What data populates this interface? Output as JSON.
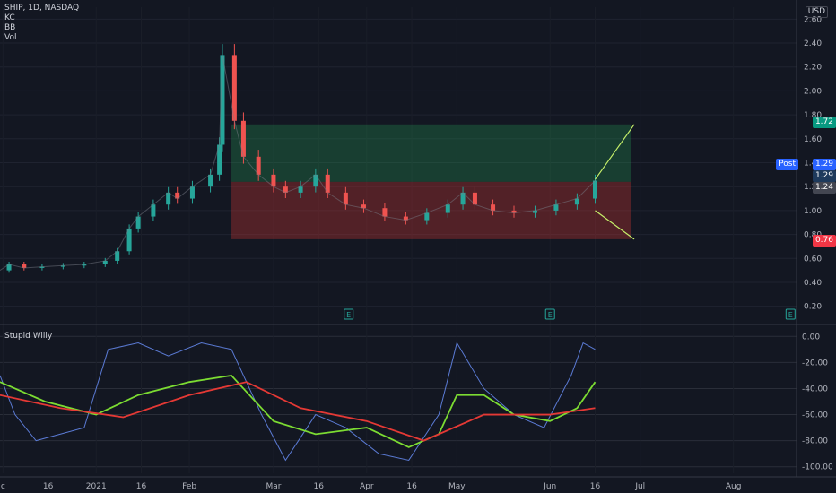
{
  "header": {
    "symbol_line": "SHIP, 1D, NASDAQ",
    "indicators": [
      "KC",
      "BB",
      "Vol"
    ]
  },
  "currency": "USD",
  "oscillator": {
    "name": "Stupid Willy"
  },
  "colors": {
    "bg": "#131722",
    "up": "#26a69a",
    "down": "#ef5350",
    "grid": "#2a2e39",
    "green_zone": "#1b5e20",
    "red_zone": "#b71c1c"
  },
  "price_tags": [
    {
      "label": "1.72",
      "value": 1.72,
      "color": "#089981"
    },
    {
      "label": "Post",
      "value": 1.29,
      "color": "#2962ff",
      "extra": "1.29"
    },
    {
      "label": "1.29",
      "value": 1.26,
      "color": "#1e3a5c"
    },
    {
      "label": "1.24",
      "value": 1.24,
      "color": "#434651"
    },
    {
      "label": "0.76",
      "value": 0.76,
      "color": "#f23645"
    }
  ],
  "chart_data": [
    {
      "type": "candlestick",
      "title": "SHIP, 1D, NASDAQ",
      "y_ticks": [
        "2.60",
        "2.40",
        "2.20",
        "2.00",
        "1.80",
        "1.60",
        "1.40",
        "1.20",
        "1.00",
        "0.80",
        "0.60",
        "0.40",
        "0.20"
      ],
      "y_tick_values": [
        2.6,
        2.4,
        2.2,
        2.0,
        1.8,
        1.6,
        1.4,
        1.2,
        1.0,
        0.8,
        0.6,
        0.4,
        0.2
      ],
      "ylim": [
        0.1,
        2.7
      ],
      "x_ticks": [
        "c",
        "16",
        "2021",
        "16",
        "Feb",
        "Mar",
        "16",
        "Apr",
        "16",
        "May",
        "Jun",
        "16",
        "Jul",
        "Aug"
      ],
      "x_tick_pos": [
        "2020-12-01",
        "2020-12-16",
        "2021-01-01",
        "2021-01-16",
        "2021-02-01",
        "2021-03-01",
        "2021-03-16",
        "2021-04-01",
        "2021-04-16",
        "2021-05-01",
        "2021-06-01",
        "2021-06-16",
        "2021-07-01",
        "2021-08-01"
      ],
      "xlim": [
        "2020-11-30",
        "2021-08-22"
      ],
      "close_series": [
        [
          "2020-11-30",
          0.5
        ],
        [
          "2020-12-03",
          0.55
        ],
        [
          "2020-12-08",
          0.52
        ],
        [
          "2020-12-14",
          0.53
        ],
        [
          "2020-12-21",
          0.54
        ],
        [
          "2020-12-28",
          0.55
        ],
        [
          "2021-01-04",
          0.58
        ],
        [
          "2021-01-08",
          0.66
        ],
        [
          "2021-01-12",
          0.85
        ],
        [
          "2021-01-15",
          0.95
        ],
        [
          "2021-01-20",
          1.05
        ],
        [
          "2021-01-25",
          1.15
        ],
        [
          "2021-01-28",
          1.1
        ],
        [
          "2021-02-02",
          1.2
        ],
        [
          "2021-02-08",
          1.3
        ],
        [
          "2021-02-11",
          1.55
        ],
        [
          "2021-02-12",
          2.3
        ],
        [
          "2021-02-16",
          1.75
        ],
        [
          "2021-02-19",
          1.45
        ],
        [
          "2021-02-24",
          1.3
        ],
        [
          "2021-03-01",
          1.2
        ],
        [
          "2021-03-05",
          1.15
        ],
        [
          "2021-03-10",
          1.2
        ],
        [
          "2021-03-15",
          1.3
        ],
        [
          "2021-03-19",
          1.15
        ],
        [
          "2021-03-25",
          1.05
        ],
        [
          "2021-03-31",
          1.02
        ],
        [
          "2021-04-07",
          0.95
        ],
        [
          "2021-04-14",
          0.92
        ],
        [
          "2021-04-21",
          0.98
        ],
        [
          "2021-04-28",
          1.05
        ],
        [
          "2021-05-03",
          1.15
        ],
        [
          "2021-05-07",
          1.05
        ],
        [
          "2021-05-13",
          1.0
        ],
        [
          "2021-05-20",
          0.98
        ],
        [
          "2021-05-27",
          1.0
        ],
        [
          "2021-06-03",
          1.05
        ],
        [
          "2021-06-10",
          1.1
        ],
        [
          "2021-06-16",
          1.25
        ]
      ],
      "zones": [
        {
          "name": "target",
          "from": 1.24,
          "to": 1.72,
          "start": "2021-02-15",
          "end": "2021-06-28"
        },
        {
          "name": "stop",
          "from": 0.76,
          "to": 1.24,
          "start": "2021-02-15",
          "end": "2021-06-28"
        }
      ],
      "arrows": [
        {
          "from": [
            "2021-06-16",
            1.26
          ],
          "to": [
            "2021-06-29",
            1.72
          ]
        },
        {
          "from": [
            "2021-06-16",
            1.0
          ],
          "to": [
            "2021-06-29",
            0.76
          ]
        }
      ],
      "earnings_markers": [
        {
          "label": "E",
          "date": "2021-03-26"
        },
        {
          "label": "E",
          "date": "2021-06-01"
        },
        {
          "label": "E",
          "date": "2021-08-20"
        }
      ]
    },
    {
      "type": "line",
      "title": "Stupid Willy",
      "y_ticks": [
        "0.00",
        "-20.00",
        "-40.00",
        "-60.00",
        "-80.00",
        "-100.00"
      ],
      "y_tick_values": [
        0,
        -20,
        -40,
        -60,
        -80,
        -100
      ],
      "ylim": [
        -105,
        5
      ],
      "series": [
        {
          "color": "#5b7bd5",
          "values": [
            [
              "2020-11-30",
              -30
            ],
            [
              "2020-12-05",
              -60
            ],
            [
              "2020-12-12",
              -80
            ],
            [
              "2020-12-20",
              -75
            ],
            [
              "2020-12-28",
              -70
            ],
            [
              "2021-01-05",
              -10
            ],
            [
              "2021-01-15",
              -5
            ],
            [
              "2021-01-25",
              -15
            ],
            [
              "2021-02-05",
              -5
            ],
            [
              "2021-02-15",
              -10
            ],
            [
              "2021-02-25",
              -60
            ],
            [
              "2021-03-05",
              -95
            ],
            [
              "2021-03-15",
              -60
            ],
            [
              "2021-03-25",
              -70
            ],
            [
              "2021-04-05",
              -90
            ],
            [
              "2021-04-15",
              -95
            ],
            [
              "2021-04-25",
              -60
            ],
            [
              "2021-05-01",
              -5
            ],
            [
              "2021-05-10",
              -40
            ],
            [
              "2021-05-20",
              -60
            ],
            [
              "2021-05-30",
              -70
            ],
            [
              "2021-06-08",
              -30
            ],
            [
              "2021-06-12",
              -5
            ],
            [
              "2021-06-16",
              -10
            ]
          ]
        },
        {
          "color": "#7cdc32",
          "values": [
            [
              "2020-11-30",
              -35
            ],
            [
              "2020-12-15",
              -50
            ],
            [
              "2021-01-01",
              -60
            ],
            [
              "2021-01-15",
              -45
            ],
            [
              "2021-02-01",
              -35
            ],
            [
              "2021-02-15",
              -30
            ],
            [
              "2021-03-01",
              -65
            ],
            [
              "2021-03-15",
              -75
            ],
            [
              "2021-04-01",
              -70
            ],
            [
              "2021-04-15",
              -85
            ],
            [
              "2021-04-25",
              -75
            ],
            [
              "2021-05-01",
              -45
            ],
            [
              "2021-05-10",
              -45
            ],
            [
              "2021-05-20",
              -60
            ],
            [
              "2021-06-01",
              -65
            ],
            [
              "2021-06-10",
              -55
            ],
            [
              "2021-06-16",
              -35
            ]
          ]
        },
        {
          "color": "#e53935",
          "values": [
            [
              "2020-11-30",
              -45
            ],
            [
              "2020-12-20",
              -55
            ],
            [
              "2021-01-10",
              -62
            ],
            [
              "2021-02-01",
              -45
            ],
            [
              "2021-02-20",
              -35
            ],
            [
              "2021-03-10",
              -55
            ],
            [
              "2021-04-01",
              -65
            ],
            [
              "2021-04-20",
              -80
            ],
            [
              "2021-05-10",
              -60
            ],
            [
              "2021-06-01",
              -60
            ],
            [
              "2021-06-16",
              -55
            ]
          ]
        }
      ]
    }
  ]
}
